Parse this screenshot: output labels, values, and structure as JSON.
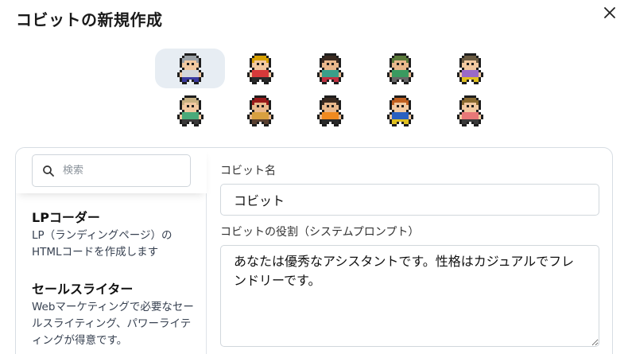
{
  "dialog": {
    "title": "コビットの新規作成"
  },
  "avatars": [
    {
      "name": "avatar-1",
      "hair": "#9aa0a6",
      "face": "#f2c9a0",
      "shirt": "#d4d8dc",
      "pants": "#3a3aa0",
      "selected": true
    },
    {
      "name": "avatar-2",
      "hair": "#d8a000",
      "face": "#f2c9a0",
      "shirt": "#d63a3a",
      "pants": "#2a2a2a",
      "selected": false
    },
    {
      "name": "avatar-3",
      "hair": "#3a2a20",
      "face": "#e9b88c",
      "shirt": "#3aa08a",
      "pants": "#c03040",
      "selected": false
    },
    {
      "name": "avatar-4",
      "hair": "#5a7a3a",
      "face": "#e9b88c",
      "shirt": "#3a9a60",
      "pants": "#666666",
      "selected": false
    },
    {
      "name": "avatar-5",
      "hair": "#6a5a40",
      "face": "#f2c9a0",
      "shirt": "#9a6ac8",
      "pants": "#e0c020",
      "selected": false
    },
    {
      "name": "avatar-6",
      "hair": "#c8b080",
      "face": "#f2c9a0",
      "shirt": "#4aaa7a",
      "pants": "#3a3a3a",
      "selected": false
    },
    {
      "name": "avatar-7",
      "hair": "#9a1a1a",
      "face": "#e9b88c",
      "shirt": "#d8a040",
      "pants": "#5a4030",
      "selected": false
    },
    {
      "name": "avatar-8",
      "hair": "#3a2a20",
      "face": "#e9b88c",
      "shirt": "#f08a20",
      "pants": "#2a2a2a",
      "selected": false
    },
    {
      "name": "avatar-9",
      "hair": "#c06020",
      "face": "#f2c9a0",
      "shirt": "#2a60c0",
      "pants": "#e0c020",
      "selected": false
    },
    {
      "name": "avatar-10",
      "hair": "#8a6a30",
      "face": "#f2c9a0",
      "shirt": "#e87878",
      "pants": "#3a3a3a",
      "selected": false
    }
  ],
  "search": {
    "placeholder": "検索"
  },
  "templates": [
    {
      "name": "LPコーダー",
      "desc": "LP（ランディングページ）のHTMLコードを作成します"
    },
    {
      "name": "セールスライター",
      "desc": "Webマーケティングで必要なセールスライティング、パワーライティングが得意です。"
    }
  ],
  "form": {
    "name_label": "コビット名",
    "name_value": "コビット",
    "role_label": "コビットの役割（システムプロンプト）",
    "role_value": "あなたは優秀なアシスタントです。性格はカジュアルでフレンドリーです。"
  },
  "colors": {
    "selected_bg": "#e7edf3",
    "border": "#d7dde3"
  },
  "icons": {
    "close": "close-icon",
    "search": "search-icon"
  }
}
